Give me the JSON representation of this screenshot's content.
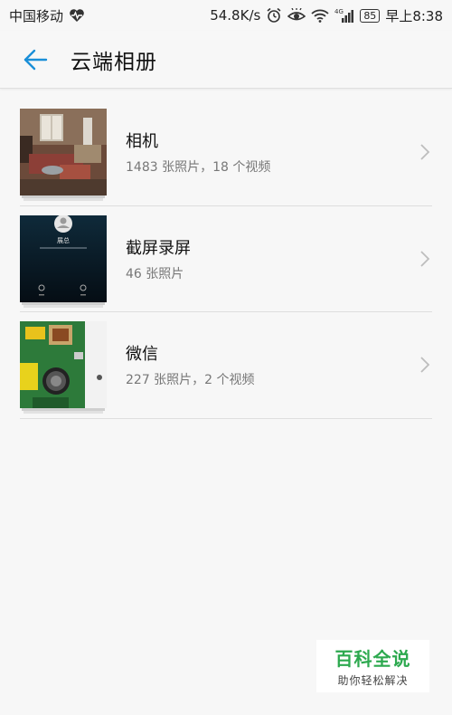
{
  "status_bar": {
    "carrier": "中国移动",
    "speed": "54.8K/s",
    "network": "4G",
    "battery": "85",
    "time": "早上8:38"
  },
  "header": {
    "title": "云端相册"
  },
  "albums": [
    {
      "name": "相机",
      "count": "1483 张照片，18 个视频"
    },
    {
      "name": "截屏录屏",
      "count": "46 张照片"
    },
    {
      "name": "微信",
      "count": "227 张照片，2 个视频"
    }
  ],
  "thumb_text": {
    "screenshot_name": "展总"
  },
  "watermark": {
    "title": "百科全说",
    "subtitle": "助你轻松解决"
  },
  "colors": {
    "accent": "#1a8fd8",
    "background": "#f7f7f7",
    "watermark_green": "#2da94f"
  }
}
